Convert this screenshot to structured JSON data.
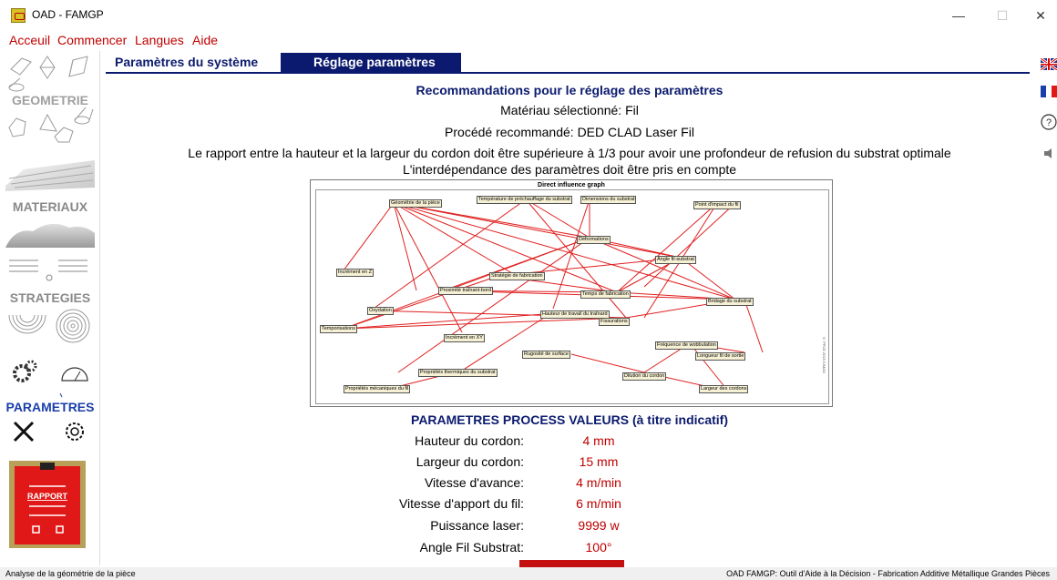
{
  "window": {
    "title": "OAD - FAMGP",
    "minimize": "—",
    "maximize": "☐",
    "close": "✕"
  },
  "menu": [
    "Acceuil",
    "Commencer",
    "Langues",
    "Aide"
  ],
  "sidebar": {
    "geometrie": "GEOMETRIE",
    "materiaux": "MATERIAUX",
    "strategies": "STRATEGIES",
    "parametres": "PARAMETRES",
    "rapport": "RAPPORT"
  },
  "tabs": [
    "Paramètres du système",
    "Réglage paramètres"
  ],
  "colors": {
    "accent_red": "#c00000",
    "navy": "#0b1a6e",
    "graph_line": "#e02020",
    "node_bg": "#f6f1d4"
  },
  "content": {
    "heading": "Recommandations pour le réglage des paramètres",
    "material": "Matériau sélectionné: Fil",
    "process": "Procédé recommandé: DED CLAD Laser Fil",
    "note1": "Le rapport entre la hauteur et la largeur du cordon doit être supérieure à 1/3 pour avoir une profondeur de refusion du substrat optimale",
    "note2": "L'interdépendance des paramètres doit être pris en compte"
  },
  "graph": {
    "title": "Direct influence graph",
    "nodes": [
      "Géométrie de la pièce",
      "Température de préchauffage du substrat",
      "Dimensions du substrat",
      "Point d'impact du fil",
      "Déformations",
      "Angle fil-substrat",
      "Incrément en Z",
      "Stratégie de fabrication",
      "Proximité traînant-bord",
      "Temps de fabrication",
      "Bridage du substrat",
      "Oxydation",
      "Hauteur de travail du traînard",
      "Fissurations",
      "Temporisations",
      "Incrément en XY",
      "Fréquence de wobbulation",
      "Rugosité de surface",
      "Longueur fil de sortie",
      "Propriétés thermiques du substrat",
      "Dilution du cordon",
      "Propriétés mécaniques du fil",
      "Largeur des cordons"
    ],
    "copyright": "© PFCE 2019 CIMAG"
  },
  "params": {
    "title": "PARAMETRES PROCESS VALEURS (à titre indicatif)",
    "rows": [
      {
        "label": "Hauteur du cordon:",
        "value": "4 mm"
      },
      {
        "label": "Largeur du cordon:",
        "value": "15 mm"
      },
      {
        "label": "Vitesse d'avance:",
        "value": "4 m/min"
      },
      {
        "label": "Vitesse d'apport du fil:",
        "value": "6 m/min"
      },
      {
        "label": "Puissance laser:",
        "value": "9999 w"
      },
      {
        "label": "Angle Fil Substrat:",
        "value": "100°"
      }
    ]
  },
  "status": {
    "left": "Analyse de la géométrie de la pièce",
    "right": "OAD FAMGP: Outil d'Aide à la Décision - Fabrication Additive Métallique Grandes Pièces"
  }
}
